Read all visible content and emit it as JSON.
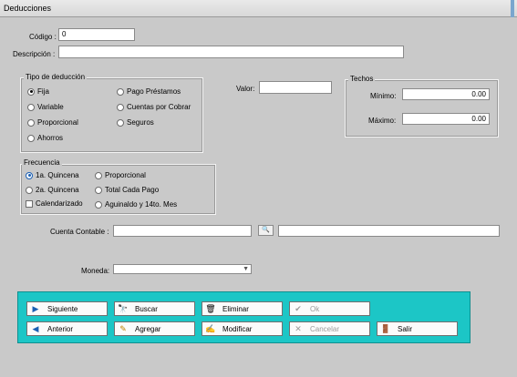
{
  "window": {
    "title": "Deducciones"
  },
  "codigo": {
    "label": "Código :",
    "value": "0"
  },
  "descripcion": {
    "label": "Descripción :",
    "value": ""
  },
  "tipo_deduccion": {
    "legend": "Tipo de deducción",
    "options": [
      "Fija",
      "Variable",
      "Proporcional",
      "Ahorros",
      "Pago Préstamos",
      "Cuentas por Cobrar",
      "Seguros"
    ],
    "selected": "Fija"
  },
  "valor": {
    "label": "Valor:",
    "value": ""
  },
  "techos": {
    "legend": "Techos",
    "minimo": {
      "label": "Mínimo:",
      "value": "0.00"
    },
    "maximo": {
      "label": "Máximo:",
      "value": "0.00"
    }
  },
  "frecuencia": {
    "legend": "Frecuencia",
    "options": [
      "1a. Quincena",
      "2a. Quincena",
      "Proporcional",
      "Total Cada Pago",
      "Aguinaldo y 14to. Mes"
    ],
    "selected": "1a. Quincena",
    "calendarizado_label": "Calendarizado"
  },
  "cuenta_contable": {
    "label": "Cuenta Contable :",
    "value": "",
    "description": ""
  },
  "moneda": {
    "label": "Moneda:",
    "value": ""
  },
  "buttons": {
    "siguiente": "Siguiente",
    "buscar": "Buscar",
    "eliminar": "Eliminar",
    "ok": "Ok",
    "anterior": "Anterior",
    "agregar": "Agregar",
    "modificar": "Modificar",
    "cancelar": "Cancelar",
    "salir": "Salir"
  },
  "colors": {
    "button_bar": "#1cc6c6",
    "background": "#c9c9c9"
  }
}
